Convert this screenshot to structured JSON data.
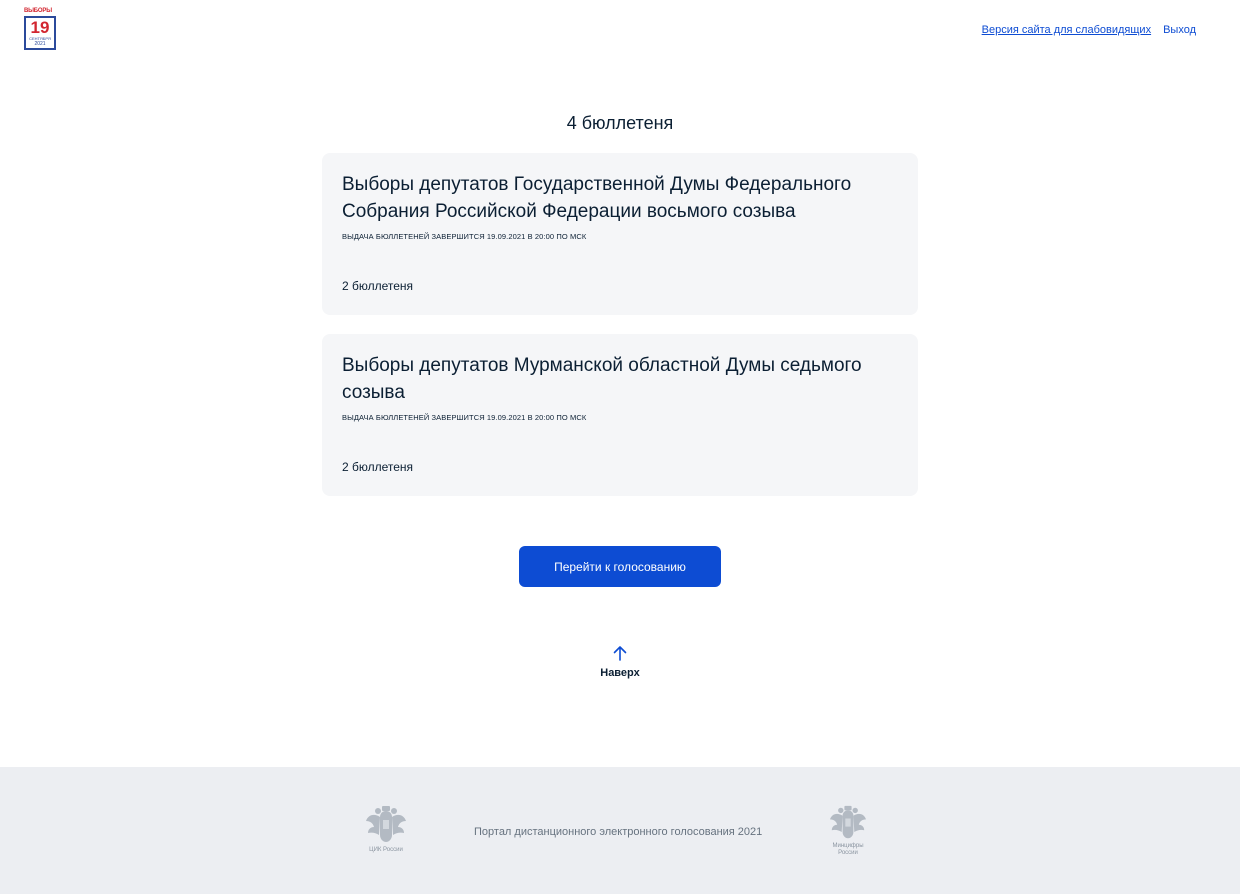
{
  "header": {
    "logo": {
      "top_text": "ВЫБОРЫ",
      "day": "19",
      "month": "СЕНТЯБРЯ",
      "year": "2021"
    },
    "nav": {
      "accessibility_link": "Версия сайта для слабовидящих",
      "logout_link": "Выход"
    }
  },
  "main": {
    "title": "4 бюллетеня",
    "cards": [
      {
        "title": "Выборы депутатов Государственной Думы Федерального Собрания Российской Федерации восьмого созыва",
        "deadline": "Выдача бюллетеней завершится 19.09.2021 в 20:00 по МСК",
        "count": "2 бюллетеня"
      },
      {
        "title": "Выборы депутатов Мурманской областной Думы седьмого созыва",
        "deadline": "Выдача бюллетеней завершится 19.09.2021 в 20:00 по МСК",
        "count": "2 бюллетеня"
      }
    ],
    "vote_button": "Перейти к голосованию",
    "to_top": "Наверх"
  },
  "footer": {
    "cik_label": "ЦИК России",
    "portal_text": "Портал дистанционного электронного голосования 2021",
    "mincifry_label": "Минцифры России"
  },
  "colors": {
    "accent": "#0d4cd3",
    "card_bg": "#f5f6f8",
    "footer_bg": "#eceef2",
    "logo_red": "#d22630",
    "logo_blue": "#2b4a9b"
  },
  "icons": {
    "logo": "elections-logo",
    "to_top": "arrow-up-icon",
    "cik": "coat-of-arms-icon",
    "mincifry": "coat-of-arms-icon"
  }
}
